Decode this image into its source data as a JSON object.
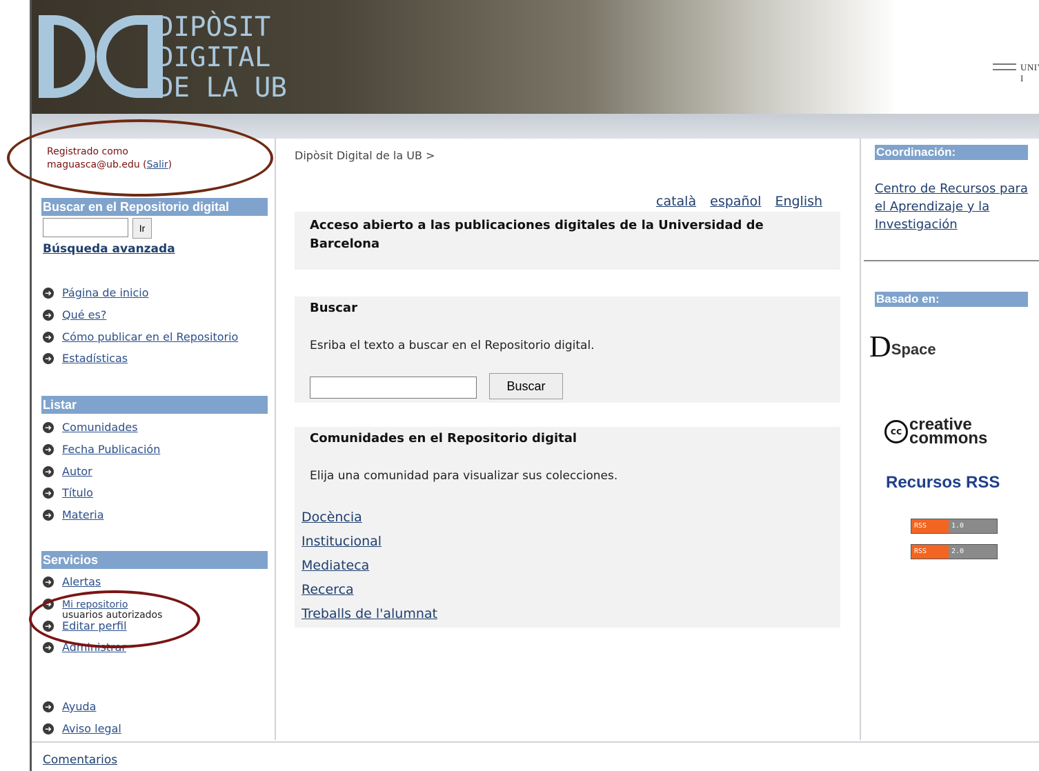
{
  "header": {
    "logo_lines": [
      "DIPÒSIT",
      "DIGITAL",
      "DE LA UB"
    ],
    "university": "UNIVERSITAT I"
  },
  "login": {
    "label": "Registrado como",
    "user": "maguasca@ub.edu",
    "logout": "Salir"
  },
  "sidebar": {
    "search_heading": "Buscar en el Repositorio digital",
    "search_button": "Ir",
    "advanced_search": "Búsqueda avanzada",
    "main_nav": [
      "Página de inicio",
      "Qué es?",
      "Cómo publicar en el Repositorio",
      "Estadísticas"
    ],
    "list_heading": "Listar",
    "list_nav": [
      "Comunidades",
      "Fecha Publicación",
      "Autor",
      "Título",
      "Materia"
    ],
    "services_heading": "Servicios",
    "services": {
      "alerts": "Alertas",
      "my_repo": "Mi repositorio",
      "my_repo_note": "usuarios autorizados",
      "edit_profile": "Editar perfil",
      "admin": "Administrar"
    },
    "help_nav": [
      "Ayuda",
      "Aviso legal"
    ]
  },
  "main": {
    "breadcrumb": "Dipòsit Digital de la UB  >",
    "languages": [
      "català",
      "español",
      "English"
    ],
    "intro": "Acceso abierto a las publicaciones digitales de la Universidad de Barcelona",
    "search": {
      "title": "Buscar",
      "text": "Esriba el texto a buscar en el Repositorio digital.",
      "button": "Buscar"
    },
    "communities": {
      "title": "Comunidades en el Repositorio digital",
      "text": "Elija una comunidad para visualizar sus colecciones.",
      "items": [
        "Docència",
        "Institucional",
        "Mediateca",
        "Recerca",
        "Treballs de l'alumnat"
      ]
    }
  },
  "right": {
    "coord_heading": "Coordinación:",
    "coord_link": "Centro de Recursos para el Aprendizaje y la Investigación",
    "based_heading": "Basado en:",
    "dspace_d": "D",
    "dspace_text": "Space",
    "cc_symbol": "cc",
    "cc_text_1": "creative",
    "cc_text_2": "commons",
    "rss_title": "Recursos RSS",
    "rss_label": "RSS",
    "rss_versions": [
      "1.0",
      "2.0"
    ]
  },
  "footer": {
    "comments": "Comentarios"
  },
  "colors": {
    "section_blue": "#7fa3cc",
    "logo_blue": "#a9c7dc",
    "annotation_oval": "#6e2a12"
  }
}
